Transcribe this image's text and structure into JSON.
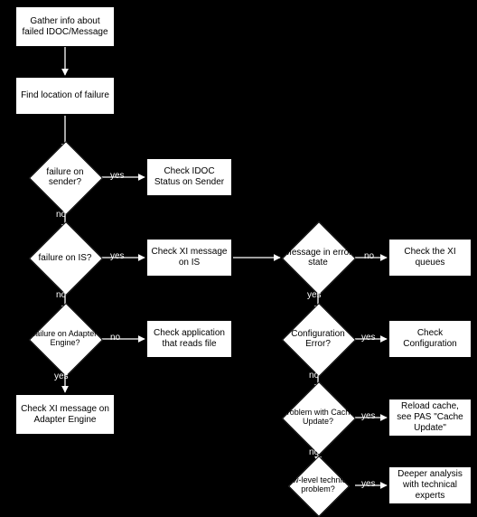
{
  "boxes": {
    "gather": "Gather info about failed IDOC/Message",
    "findloc": "Find location of failure",
    "check_idoc": "Check IDOC Status on Sender",
    "check_xi_is": "Check XI message on IS",
    "check_xi_queues": "Check the XI queues",
    "check_app": "Check application that reads file",
    "check_config": "Check Configuration",
    "check_xi_ae": "Check XI message on Adapter Engine",
    "reload_cache": "Reload cache, see PAS \"Cache Update\"",
    "deeper": "Deeper analysis with technical experts"
  },
  "diamonds": {
    "fail_sender": "failure on sender?",
    "fail_is": "failure on IS?",
    "fail_ae": "failure on Adapter Engine?",
    "msg_err": "Message in error state",
    "conf_err": "Configuration Error?",
    "cache_upd": "Problem with Cache Update?",
    "lowlevel": "Low-level technical problem?"
  },
  "labels": {
    "yes": "yes",
    "no": "no"
  },
  "chart_data": {
    "type": "flowchart",
    "nodes": [
      {
        "id": "gather",
        "kind": "process",
        "text": "Gather info about failed IDOC/Message"
      },
      {
        "id": "findloc",
        "kind": "process",
        "text": "Find location of failure"
      },
      {
        "id": "fail_sender",
        "kind": "decision",
        "text": "failure on sender?"
      },
      {
        "id": "check_idoc",
        "kind": "process",
        "text": "Check IDOC Status on Sender"
      },
      {
        "id": "fail_is",
        "kind": "decision",
        "text": "failure on IS?"
      },
      {
        "id": "check_xi_is",
        "kind": "process",
        "text": "Check XI message on IS"
      },
      {
        "id": "fail_ae",
        "kind": "decision",
        "text": "failure on Adapter Engine?"
      },
      {
        "id": "check_app",
        "kind": "process",
        "text": "Check application that reads file"
      },
      {
        "id": "check_xi_ae",
        "kind": "process",
        "text": "Check XI message on Adapter Engine"
      },
      {
        "id": "msg_err",
        "kind": "decision",
        "text": "Message in error state"
      },
      {
        "id": "check_xi_queues",
        "kind": "process",
        "text": "Check the XI queues"
      },
      {
        "id": "conf_err",
        "kind": "decision",
        "text": "Configuration Error?"
      },
      {
        "id": "check_config",
        "kind": "process",
        "text": "Check Configuration"
      },
      {
        "id": "cache_upd",
        "kind": "decision",
        "text": "Problem with Cache Update?"
      },
      {
        "id": "reload_cache",
        "kind": "process",
        "text": "Reload cache, see PAS \"Cache Update\""
      },
      {
        "id": "lowlevel",
        "kind": "decision",
        "text": "Low-level technical problem?"
      },
      {
        "id": "deeper",
        "kind": "process",
        "text": "Deeper analysis with technical experts"
      }
    ],
    "edges": [
      {
        "from": "gather",
        "to": "findloc"
      },
      {
        "from": "findloc",
        "to": "fail_sender"
      },
      {
        "from": "fail_sender",
        "to": "check_idoc",
        "label": "yes"
      },
      {
        "from": "fail_sender",
        "to": "fail_is",
        "label": "no"
      },
      {
        "from": "fail_is",
        "to": "check_xi_is",
        "label": "yes"
      },
      {
        "from": "fail_is",
        "to": "fail_ae",
        "label": "no"
      },
      {
        "from": "fail_ae",
        "to": "check_xi_ae",
        "label": "yes"
      },
      {
        "from": "fail_ae",
        "to": "check_app",
        "label": "no"
      },
      {
        "from": "check_xi_is",
        "to": "msg_err"
      },
      {
        "from": "msg_err",
        "to": "check_xi_queues",
        "label": "no"
      },
      {
        "from": "msg_err",
        "to": "conf_err",
        "label": "yes"
      },
      {
        "from": "conf_err",
        "to": "check_config",
        "label": "yes"
      },
      {
        "from": "conf_err",
        "to": "cache_upd",
        "label": "no"
      },
      {
        "from": "cache_upd",
        "to": "reload_cache",
        "label": "yes"
      },
      {
        "from": "cache_upd",
        "to": "lowlevel",
        "label": "no"
      },
      {
        "from": "lowlevel",
        "to": "deeper",
        "label": "yes"
      }
    ]
  }
}
